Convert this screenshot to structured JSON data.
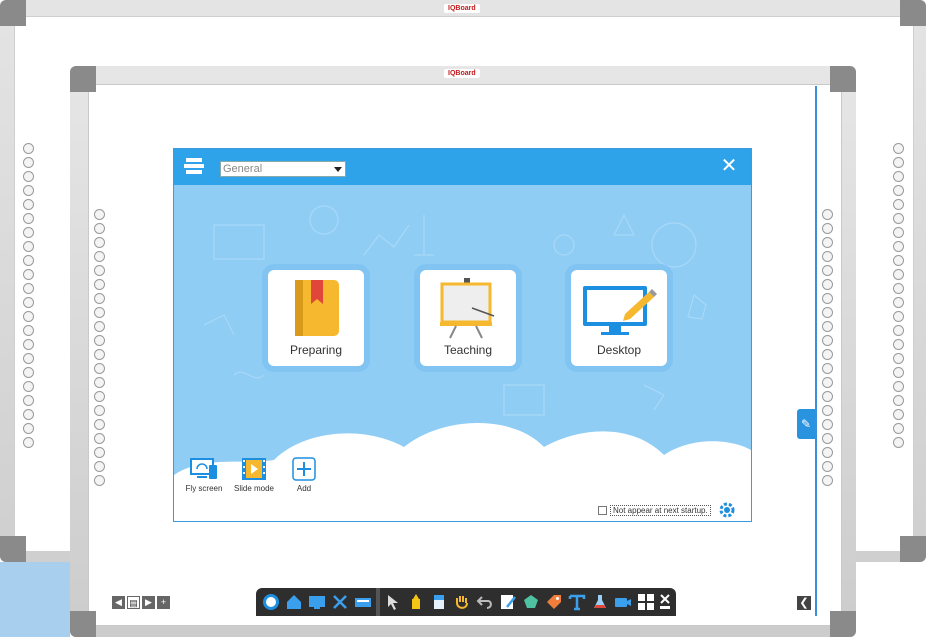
{
  "brand": {
    "logo_text": "IQBoard"
  },
  "dialog": {
    "category_select": {
      "value": "General"
    },
    "close_glyph": "✕",
    "modes": [
      {
        "label": "Preparing"
      },
      {
        "label": "Teaching"
      },
      {
        "label": "Desktop"
      }
    ],
    "tools": [
      {
        "label": "Fly screen"
      },
      {
        "label": "Slide mode"
      },
      {
        "label": "Add"
      }
    ],
    "startup_checkbox": {
      "label": "Not appear at next startup.",
      "checked": false
    }
  },
  "colors": {
    "header": "#2ea3ea",
    "body": "#8fcdf5",
    "accent": "#2a93e0",
    "book": "#f5b82e",
    "bookmark": "#e0463a",
    "toolbar": "#2e2e2e"
  },
  "toolbar": {
    "icons": [
      "iq-logo-icon",
      "home-icon",
      "screen-icon",
      "tools-icon",
      "keyboard-icon",
      "pointer-icon",
      "highlighter-icon",
      "eraser-icon",
      "hand-icon",
      "undo-icon",
      "pen-icon",
      "shapes-icon",
      "tag-icon",
      "text-icon",
      "flask-icon",
      "camera-icon",
      "grid-icon",
      "close-icon"
    ]
  }
}
